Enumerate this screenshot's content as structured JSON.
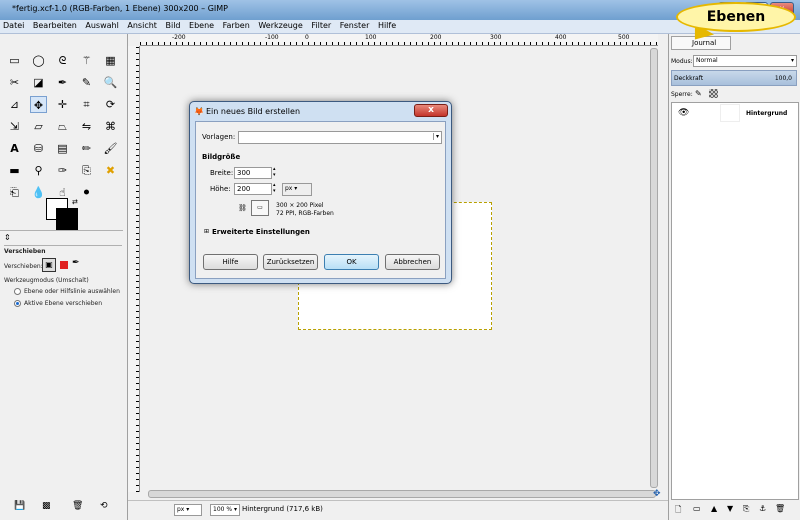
{
  "window": {
    "title": "*fertig.xcf-1.0 (RGB-Farben, 1 Ebene) 300x200 – GIMP"
  },
  "menu": [
    "Datei",
    "Bearbeiten",
    "Auswahl",
    "Ansicht",
    "Bild",
    "Ebene",
    "Farben",
    "Werkzeuge",
    "Filter",
    "Fenster",
    "Hilfe"
  ],
  "ruler": {
    "h_labels": [
      "-200",
      "-100",
      "0",
      "100",
      "200",
      "300",
      "400",
      "500"
    ]
  },
  "tool_options": {
    "title": "Verschieben",
    "move_label": "Verschieben:",
    "mode_label": "Werkzeugmodus (Umschalt)",
    "radio1": "Ebene oder Hilfslinie auswählen",
    "radio2": "Aktive Ebene verschieben"
  },
  "dialog": {
    "title": "Ein neues Bild erstellen",
    "close": "x",
    "template_label": "Vorlagen:",
    "image_size_label": "Bildgröße",
    "width_label": "Breite:",
    "width_value": "300",
    "height_label": "Höhe:",
    "height_value": "200",
    "unit": "px",
    "info_line1": "300 × 200 Pixel",
    "info_line2": "72 PPI, RGB-Farben",
    "advanced": "Erweiterte Einstellungen",
    "btn_help": "Hilfe",
    "btn_reset": "Zurücksetzen",
    "btn_ok": "OK",
    "btn_cancel": "Abbrechen"
  },
  "statusbar": {
    "unit": "px",
    "zoom": "100 %",
    "info": "Hintergrund (717,6 kB)"
  },
  "layers": {
    "tab_journal": "Journal",
    "mode_label": "Modus:",
    "mode_value": "Normal",
    "opacity_label": "Deckkraft",
    "opacity_value": "100,0",
    "lock_label": "Sperre:",
    "layer_name": "Hintergrund"
  },
  "callout": "Ebenen"
}
